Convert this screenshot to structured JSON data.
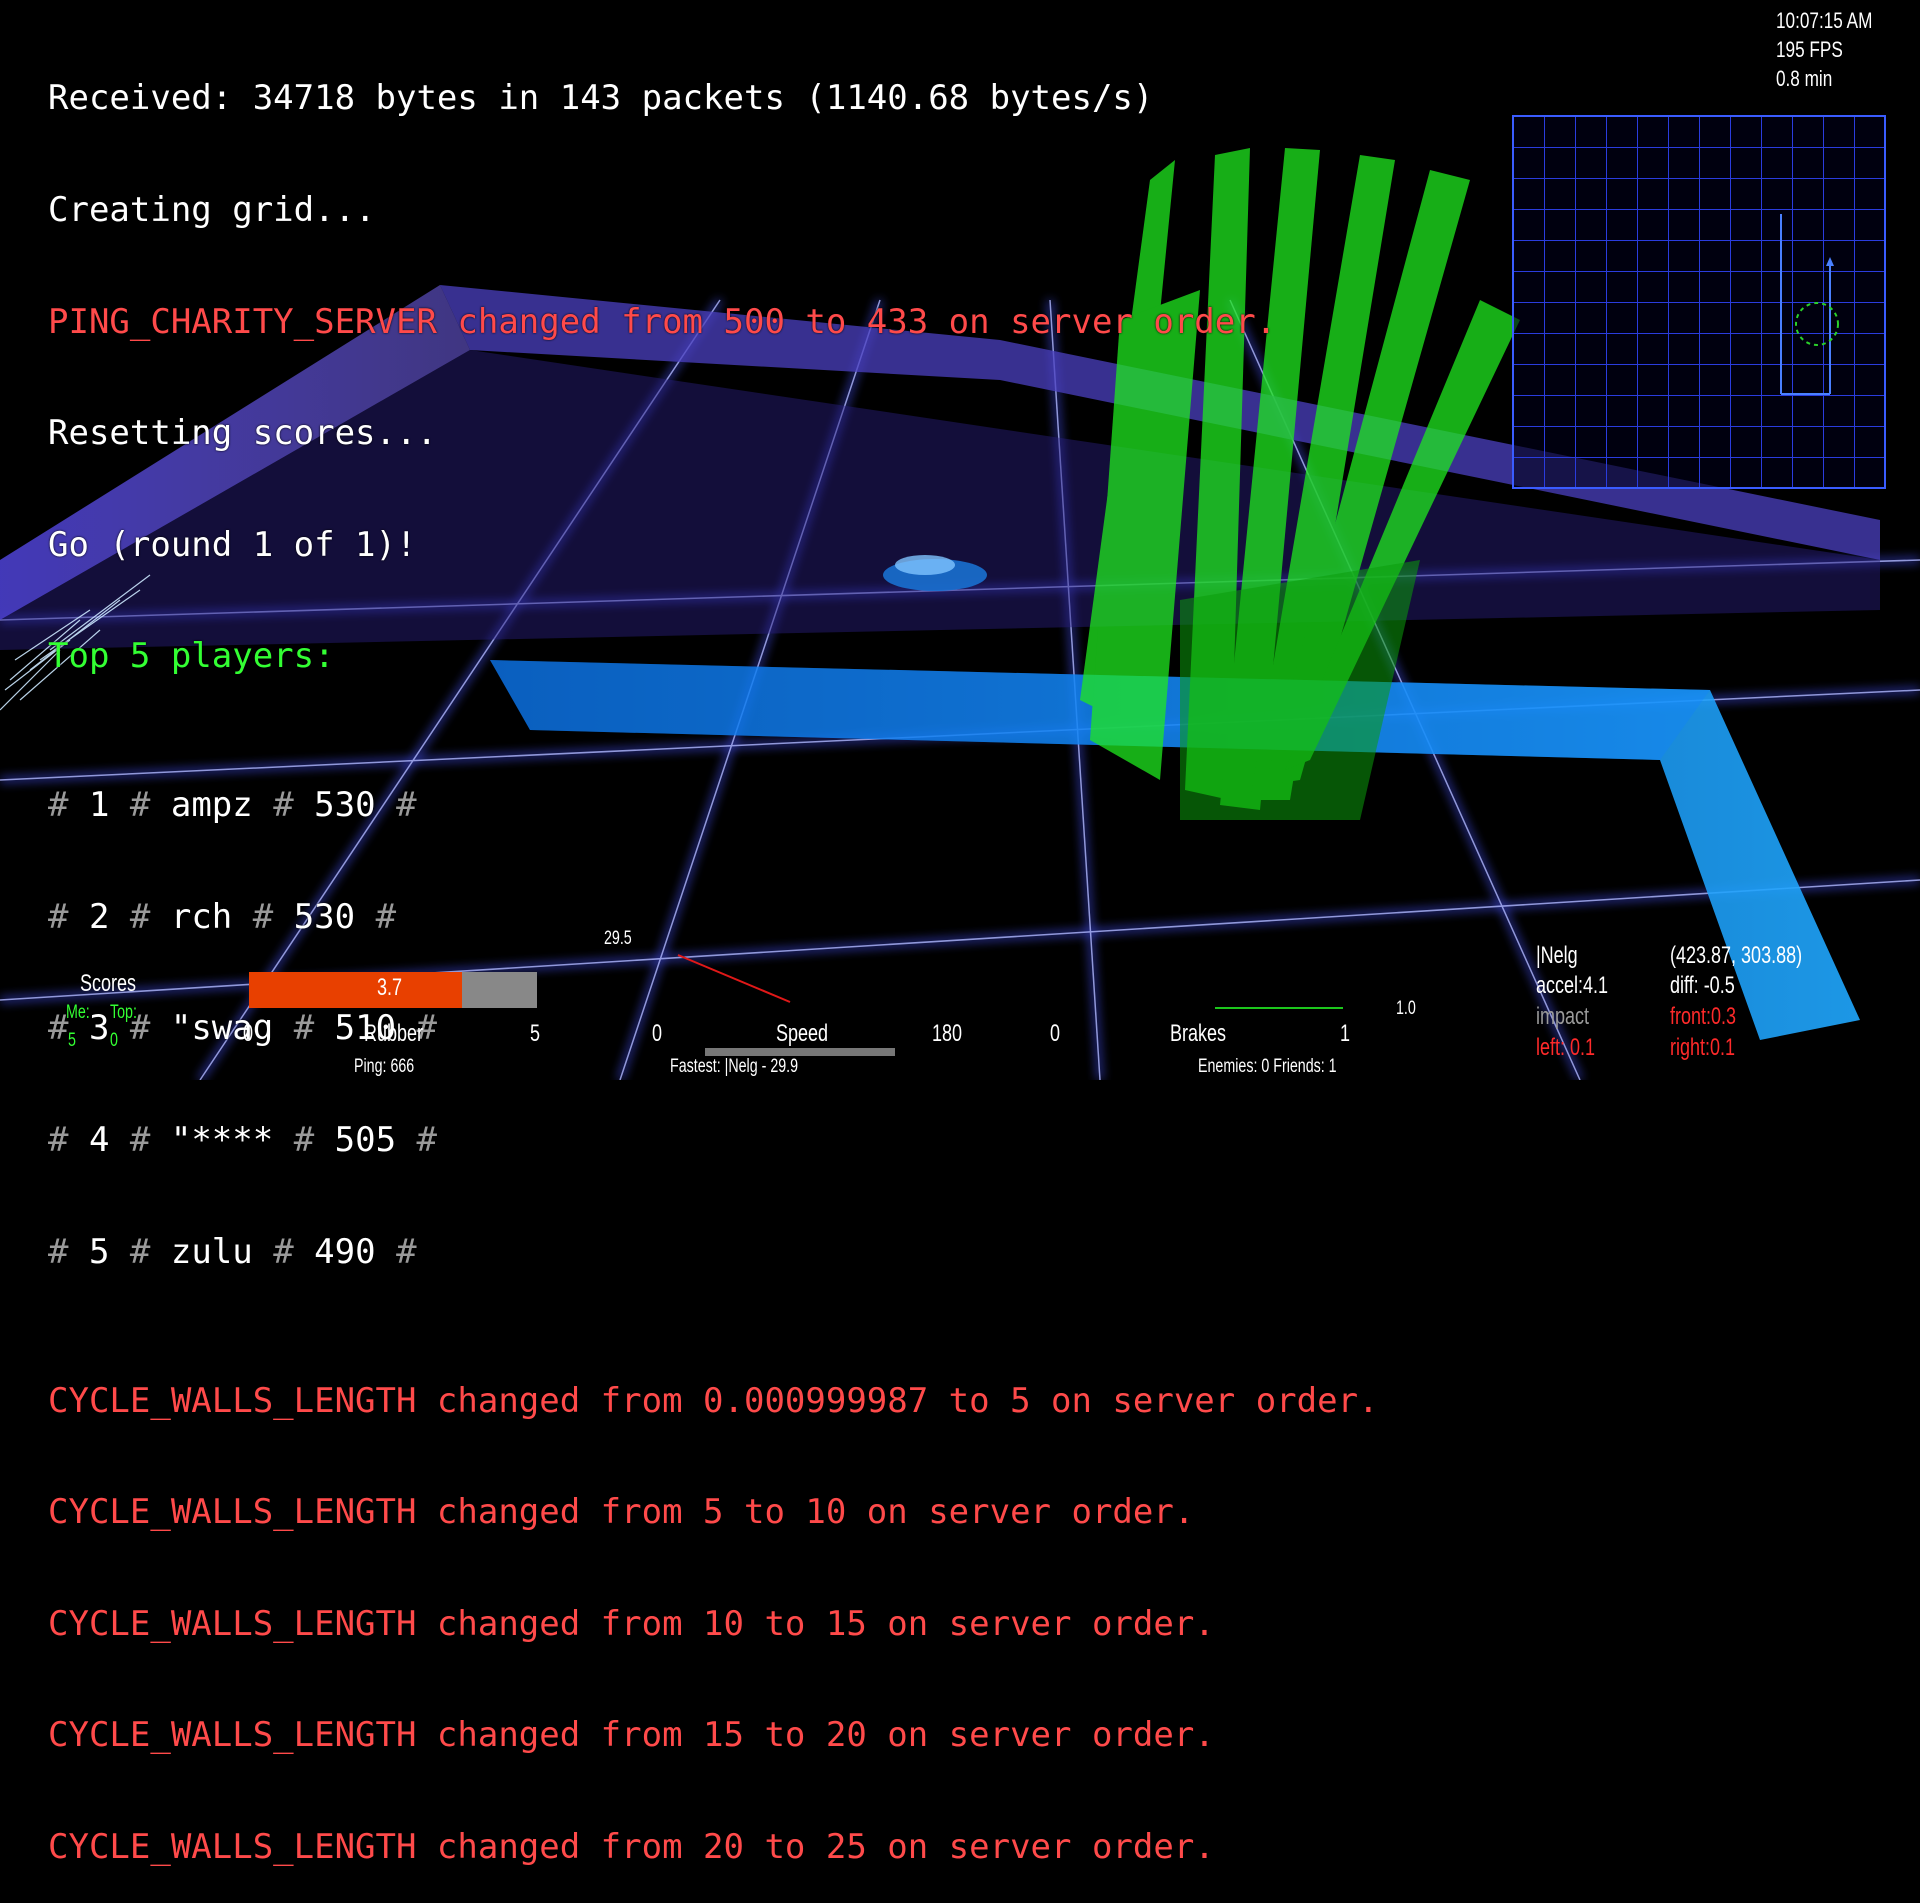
{
  "console": {
    "lines": [
      {
        "text": "Received: 34718 bytes in 143 packets (1140.68 bytes/s)",
        "color": "#ffffff"
      },
      {
        "text": "Creating grid...",
        "color": "#ffffff"
      },
      {
        "text": "PING_CHARITY_SERVER changed from 500 to 433 on server order.",
        "color": "#ff4a4a"
      },
      {
        "text": "Resetting scores...",
        "color": "#ffffff"
      },
      {
        "text": "Go (round 1 of 1)!",
        "color": "#ffffff"
      },
      {
        "text": "Top 5 players:",
        "color": "#33ff33"
      }
    ],
    "top_players": [
      {
        "rank": "1",
        "name": "ampz",
        "score": "530"
      },
      {
        "rank": "2",
        "name": "rch",
        "score": "530"
      },
      {
        "rank": "3",
        "name": "\"swag",
        "score": "510"
      },
      {
        "rank": "4",
        "name": "\"****",
        "score": "505"
      },
      {
        "rank": "5",
        "name": "zulu",
        "score": "490"
      }
    ],
    "server_lines": [
      "CYCLE_WALLS_LENGTH changed from 0.000999987 to 5 on server order.",
      "CYCLE_WALLS_LENGTH changed from 5 to 10 on server order.",
      "CYCLE_WALLS_LENGTH changed from 10 to 15 on server order.",
      "CYCLE_WALLS_LENGTH changed from 15 to 20 on server order.",
      "CYCLE_WALLS_LENGTH changed from 20 to 25 on server order."
    ]
  },
  "topright": {
    "time": "10:07:15 AM",
    "fps": "195 FPS",
    "elapsed": "0.8 min"
  },
  "scores": {
    "title": "Scores",
    "me_label": "Me:",
    "top_label": "Top:",
    "me": "5",
    "top": "0"
  },
  "rubber": {
    "value": "3.7",
    "fill": 0.74,
    "min": "0",
    "max": "5",
    "label": "Rubber",
    "ping": "Ping:  666"
  },
  "speed": {
    "value": "29.5",
    "min": "0",
    "max": "180",
    "label": "Speed",
    "fastest": "Fastest:  |Nelg  -  29.9"
  },
  "brakes": {
    "value": "1.0",
    "min": "0",
    "max": "1",
    "label": "Brakes",
    "counts": "Enemies:  0  Friends:  1"
  },
  "player_info": {
    "name": "|Nelg",
    "accel": "accel:4.1",
    "impact": "impact",
    "left": "left: 0.1",
    "pos": "(423.87, 303.88)",
    "diff": "diff: -0.5",
    "front": "front:0.3",
    "right": "right:0.1"
  },
  "colors": {
    "white": "#ffffff",
    "red": "#ff2a2a",
    "green": "#33ff33",
    "gray": "#9a9a9a",
    "rubber_fill": "#e84000",
    "rubber_bg": "#888888",
    "grid": "#3a5cff"
  }
}
